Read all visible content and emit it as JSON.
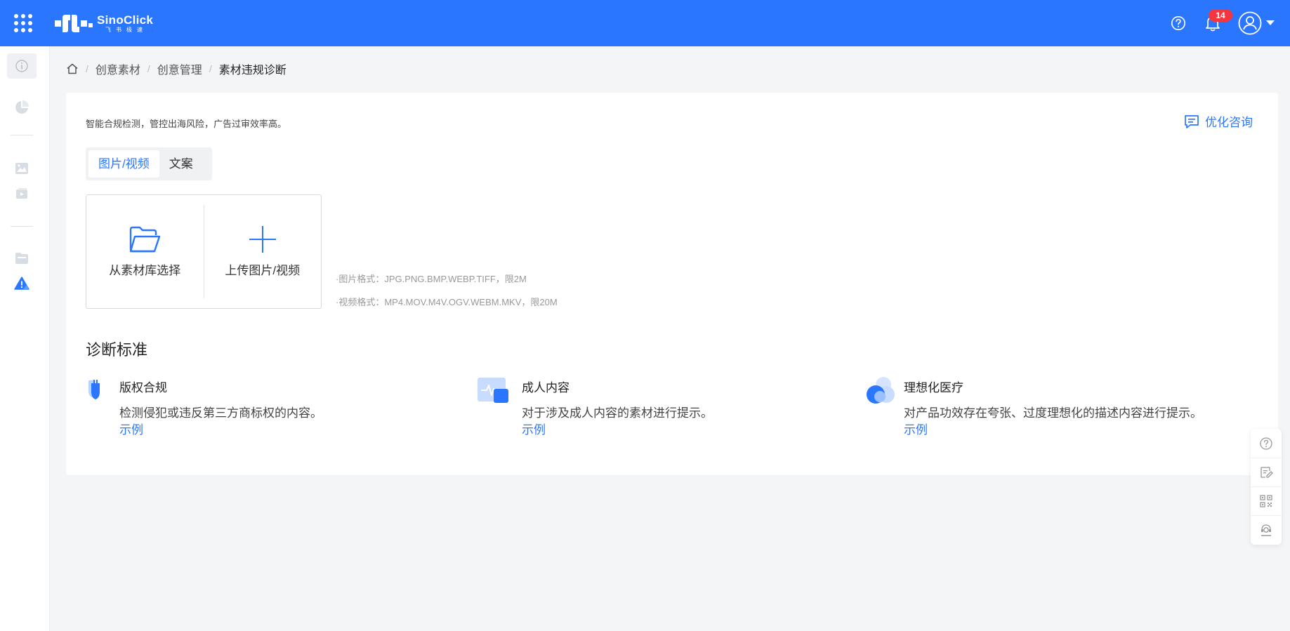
{
  "header": {
    "logo_text": "SinoClick",
    "logo_subtext": "飞书极速",
    "notification_count": "14"
  },
  "breadcrumb": {
    "items": [
      "创意素材",
      "创意管理"
    ],
    "current": "素材违规诊断",
    "separator": "/"
  },
  "card": {
    "intro": "智能合规检测，管控出海风险，广告过审效率高。",
    "consult_label": "优化咨询",
    "tabs": [
      {
        "label": "图片/视频",
        "active": true
      },
      {
        "label": "文案",
        "active": false
      }
    ],
    "upload": {
      "from_library": "从素材库选择",
      "upload_local": "上传图片/视频"
    },
    "formats": {
      "image": "·图片格式：JPG.PNG.BMP.WEBP.TIFF，限2M",
      "video": "·视频格式：MP4.MOV.M4V.OGV.WEBM.MKV，限20M"
    },
    "criteria_title": "诊断标准",
    "criteria": [
      {
        "title": "版权合规",
        "desc": "检测侵犯或违反第三方商标权的内容。",
        "link": "示例"
      },
      {
        "title": "成人内容",
        "desc": "对于涉及成人内容的素材进行提示。",
        "link": "示例"
      },
      {
        "title": "理想化医疗",
        "desc": "对产品功效存在夸张、过度理想化的描述内容进行提示。",
        "link": "示例"
      }
    ]
  },
  "colors": {
    "brand_blue": "#2a76ff",
    "badge_red": "#f5363f",
    "page_bg": "#f4f5f7"
  },
  "icons": {
    "sidebar": [
      "info-icon",
      "pie-chart-icon",
      "image-icon",
      "video-icon",
      "folder-icon",
      "warning-icon"
    ],
    "float_toolbar": [
      "help-icon",
      "feedback-icon",
      "qrcode-icon",
      "customer-service-icon"
    ]
  }
}
